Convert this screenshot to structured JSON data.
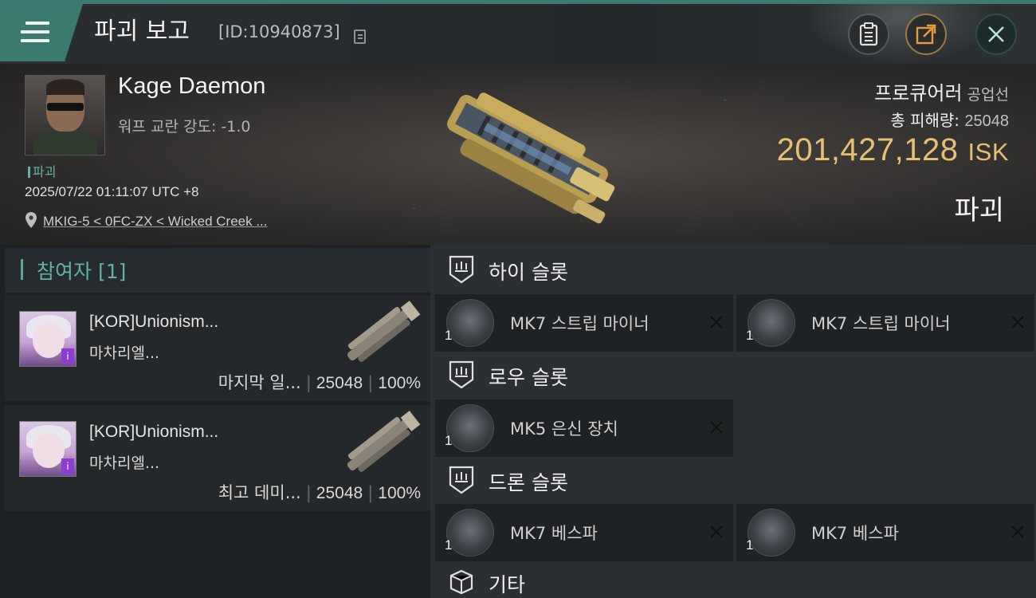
{
  "header": {
    "title": "파괴 보고",
    "id_label": "[ID:10940873]",
    "icons": [
      "menu-icon",
      "copy-icon",
      "clipboard-icon",
      "share-icon",
      "close-icon"
    ]
  },
  "victim": {
    "name": "Kage Daemon",
    "warp": "워프 교란 강도: -1.0",
    "tag": "파괴",
    "datetime": "2025/07/22 01:11:07 UTC +8",
    "location": "MKIG-5 < 0FC-ZX < Wicked Creek ..."
  },
  "ship": {
    "name": "프로큐어러",
    "class": "공업선",
    "total_damage_label": "총 피해량:",
    "total_damage_value": "25048",
    "isk_value": "201,427,128",
    "isk_unit": "ISK",
    "status": "파괴"
  },
  "participants": {
    "header": "참여자 [1]",
    "items": [
      {
        "name": "[KOR]Unionism...",
        "ship": "마차리엘...",
        "role": "마지막 일...",
        "damage": "25048",
        "percent": "100%"
      },
      {
        "name": "[KOR]Unionism...",
        "ship": "마차리엘...",
        "role": "최고 데미...",
        "damage": "25048",
        "percent": "100%"
      }
    ]
  },
  "slots": {
    "high": {
      "title": "하이 슬롯",
      "modules": [
        {
          "name": "MK7 스트립 마이너",
          "qty": "1"
        },
        {
          "name": "MK7 스트립 마이너",
          "qty": "1"
        }
      ]
    },
    "low": {
      "title": "로우 슬롯",
      "modules": [
        {
          "name": "MK5 은신 장치",
          "qty": "1"
        }
      ]
    },
    "drone": {
      "title": "드론 슬롯",
      "modules": [
        {
          "name": "MK7  베스파",
          "qty": "1"
        },
        {
          "name": "MK7  베스파",
          "qty": "1"
        }
      ]
    },
    "other": {
      "title": "기타"
    }
  },
  "colors": {
    "accent": "#3c7a70",
    "teal_text": "#5fb3a5",
    "isk_gold": "#e6c072",
    "panel_dark": "#1e2124",
    "panel_mid": "#2b2f33"
  }
}
